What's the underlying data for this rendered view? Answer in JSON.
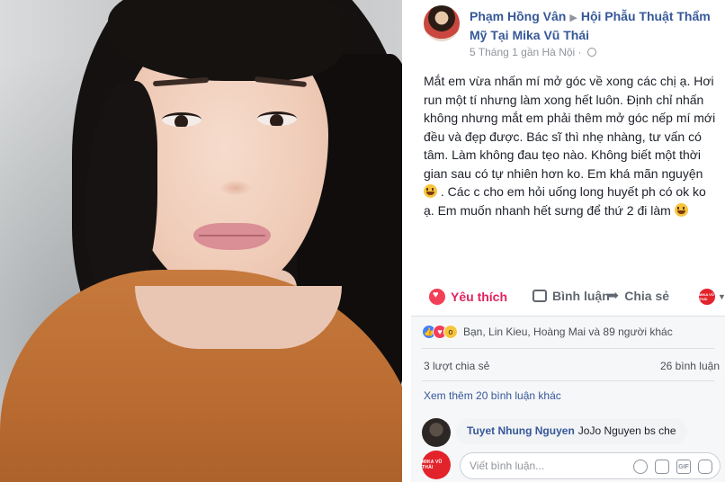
{
  "post": {
    "author": "Phạm Hồng Vân",
    "page": "Hội Phẫu Thuật Thẩm Mỹ Tại Mika Vũ Thái",
    "meta": "5 Tháng 1 gần Hà Nội ·",
    "text": "Mắt em vừa nhấn mí mở góc về xong các chị ạ. Hơi run một tí nhưng làm xong hết luôn. Định chỉ nhấn không nhưng mắt em phải thêm mở góc nếp mí mới đều và đẹp được. Bác sĩ thì nhẹ nhàng, tư vấn có tâm. Làm không đau tẹo nào. Không biết một thời gian sau có tự nhiên hơn ko. Em khá mãn nguyện",
    "text2": ". Các c cho em hỏi uống long huyết ph có ok ko ạ. Em muốn nhanh hết sưng để thứ 2 đi làm"
  },
  "actions": {
    "like": "Yêu thích",
    "comment": "Bình luận",
    "share": "Chia sẻ",
    "page_logo": "MIKA VŨ THÁI"
  },
  "stats": {
    "reactions": "Bạn, Lin Kieu, Hoàng Mai và 89 người khác",
    "shares": "3 lượt chia sẻ",
    "comments": "26 bình luận",
    "more_comments": "Xem thêm 20 bình luận khác"
  },
  "comment": {
    "name": "Tuyet Nhung Nguyen",
    "text": "JoJo Nguyen bs che"
  },
  "composer": {
    "placeholder": "Viết bình luận...",
    "avatar_text": "MIKA VŨ THÁI",
    "gif_label": "GIF"
  },
  "icons": [
    "heart-icon",
    "comment-icon",
    "share-icon",
    "globe-icon",
    "emoji-icon",
    "camera-icon",
    "gif-icon",
    "sticker-icon"
  ],
  "colors": {
    "link": "#365899",
    "love": "#e0245e",
    "brand": "#e3232b"
  }
}
